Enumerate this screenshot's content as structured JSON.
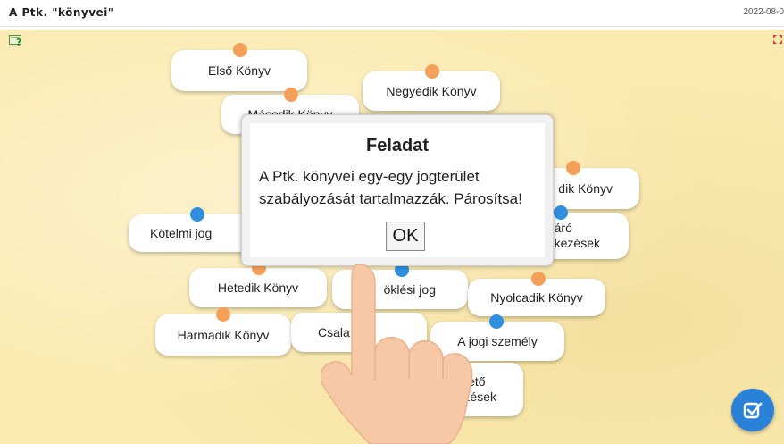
{
  "header": {
    "title": "A Ptk. \"könyvei\"",
    "date": "2022-08-0"
  },
  "cards": [
    {
      "label": "Első Könyv",
      "dot": "orange"
    },
    {
      "label": "Negyedik Könyv",
      "dot": "orange"
    },
    {
      "label": "Második Könyv",
      "dot": "orange"
    },
    {
      "label": "dik Könyv",
      "dot": "orange"
    },
    {
      "label": "Kötelmi jog",
      "dot": "blue"
    },
    {
      "label_line1": "áró",
      "label_line2": "kezések",
      "dot": "blue"
    },
    {
      "label": "Hetedik Könyv",
      "dot": "orange"
    },
    {
      "label": "öklési jog",
      "dot": "blue"
    },
    {
      "label": "Nyolcadik Könyv",
      "dot": "orange"
    },
    {
      "label": "Harmadik Könyv",
      "dot": "orange"
    },
    {
      "label": "Csala",
      "dot": "blue"
    },
    {
      "label": "A jogi személy",
      "dot": "blue"
    },
    {
      "label_line1": "rezető",
      "label_line2": "kezések",
      "dot": "blue"
    }
  ],
  "dialog": {
    "title": "Feladat",
    "body": "A Ptk. könyvei egy-egy jogterület szabályozását tartalmazzák. Párosítsa!",
    "ok_label": "OK"
  },
  "icons": {
    "help": "help-icon",
    "fullscreen": "fullscreen-icon",
    "check": "check-icon",
    "hand": "pointing-hand-icon"
  },
  "colors": {
    "board": "#fbeab0",
    "orange_dot": "#f5a05a",
    "blue_dot": "#2f8fde",
    "check_button": "#2a82d8"
  }
}
